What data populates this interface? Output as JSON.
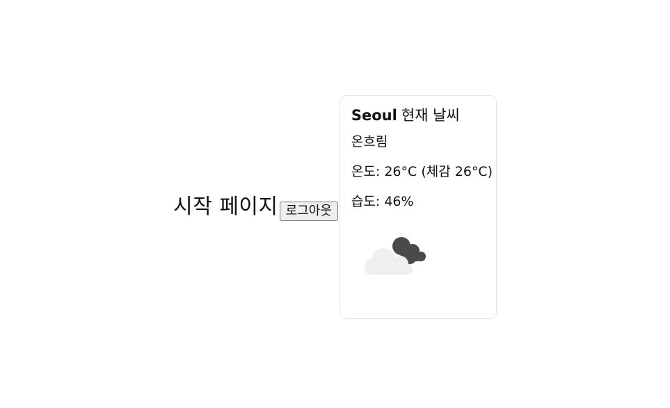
{
  "page": {
    "title": "시작 페이지",
    "logout_label": "로그아웃"
  },
  "weather": {
    "city": "Seoul",
    "heading_suffix": "현재 날씨",
    "description": "온흐림",
    "temperature_label": "온도:",
    "temperature": "26°C",
    "feels_like_label": "(체감",
    "feels_like": "26°C)",
    "humidity_label": "습도:",
    "humidity": "46%",
    "icon": "broken-clouds-icon"
  },
  "colors": {
    "cloud_light": "#efefef",
    "cloud_dark": "#4a4a4a",
    "card_border": "#e6e6e6"
  }
}
